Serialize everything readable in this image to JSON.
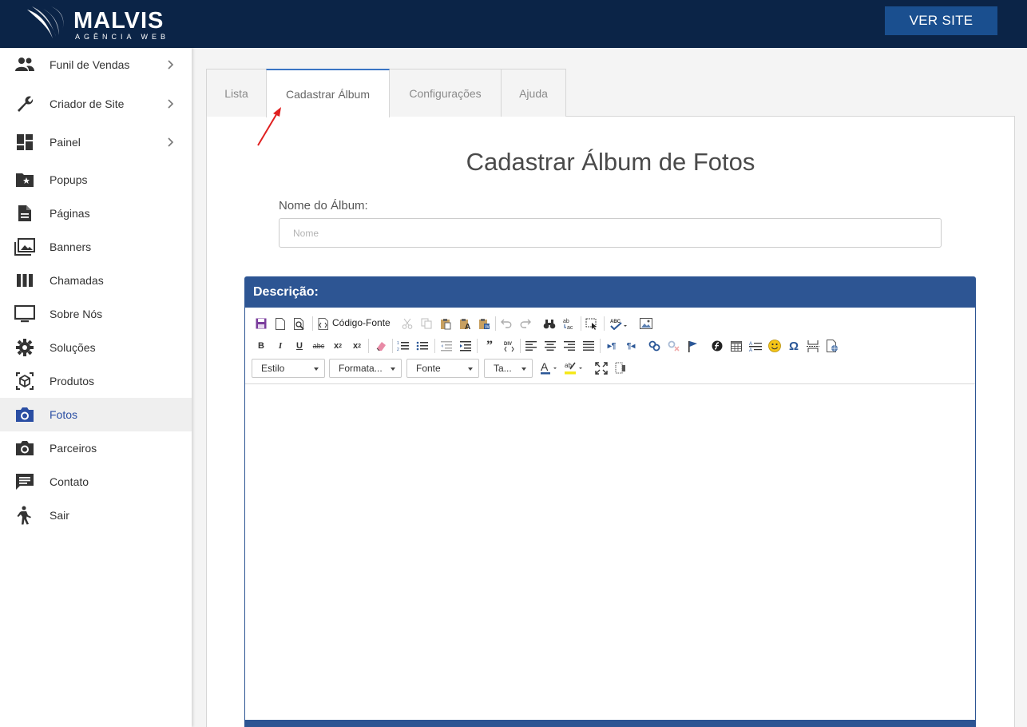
{
  "brand": {
    "name": "MALVIS",
    "tagline": "AGÊNCIA WEB",
    "header_button": "VER SITE",
    "colors": {
      "header": "#0b2447",
      "button": "#1a4f8f",
      "accent": "#2d5593",
      "active_nav": "#2a4ea3"
    }
  },
  "sidebar": {
    "items": [
      {
        "label": "Funil de Vendas",
        "icon": "people-icon",
        "submenu": true,
        "active": false
      },
      {
        "label": "Criador de Site",
        "icon": "wrench-icon",
        "submenu": true,
        "active": false
      },
      {
        "label": "Painel",
        "icon": "dashboard-icon",
        "submenu": true,
        "active": false
      },
      {
        "label": "Popups",
        "icon": "folder-star-icon",
        "submenu": false,
        "active": false
      },
      {
        "label": "Páginas",
        "icon": "document-icon",
        "submenu": false,
        "active": false
      },
      {
        "label": "Banners",
        "icon": "image-stack-icon",
        "submenu": false,
        "active": false
      },
      {
        "label": "Chamadas",
        "icon": "columns-icon",
        "submenu": false,
        "active": false
      },
      {
        "label": "Sobre Nós",
        "icon": "monitor-icon",
        "submenu": false,
        "active": false
      },
      {
        "label": "Soluções",
        "icon": "gear-icon",
        "submenu": false,
        "active": false
      },
      {
        "label": "Produtos",
        "icon": "cube-icon",
        "submenu": false,
        "active": false
      },
      {
        "label": "Fotos",
        "icon": "camera-icon",
        "submenu": false,
        "active": true
      },
      {
        "label": "Parceiros",
        "icon": "camera-icon",
        "submenu": false,
        "active": false
      },
      {
        "label": "Contato",
        "icon": "chat-icon",
        "submenu": false,
        "active": false
      },
      {
        "label": "Sair",
        "icon": "person-exit-icon",
        "submenu": false,
        "active": false
      }
    ]
  },
  "tabs": [
    {
      "label": "Lista",
      "active": false
    },
    {
      "label": "Cadastrar Álbum",
      "active": true
    },
    {
      "label": "Configurações",
      "active": false
    },
    {
      "label": "Ajuda",
      "active": false
    }
  ],
  "form": {
    "title": "Cadastrar Álbum de Fotos",
    "name_label": "Nome do Álbum:",
    "name_placeholder": "Nome",
    "name_value": ""
  },
  "editor": {
    "header": "Descrição:",
    "source_button": "Código-Fonte",
    "combos": [
      "Estilo",
      "Formata...",
      "Fonte",
      "Ta..."
    ],
    "content": ""
  }
}
